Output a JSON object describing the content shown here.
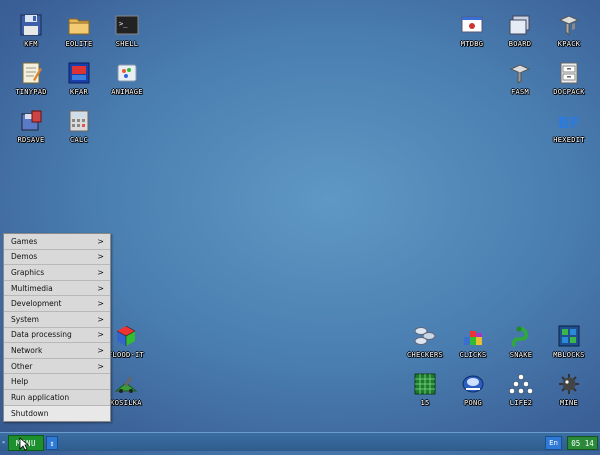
{
  "desktop": {
    "icons": [
      {
        "id": "kfm",
        "label": "KFM",
        "icon": "floppy-icon"
      },
      {
        "id": "eolite",
        "label": "EOLITE",
        "icon": "folder-icon"
      },
      {
        "id": "shell",
        "label": "SHELL",
        "icon": "terminal-icon"
      },
      {
        "id": "tinypad",
        "label": "TINYPAD",
        "icon": "notepad-icon"
      },
      {
        "id": "kfar",
        "label": "KFAR",
        "icon": "kfar-icon"
      },
      {
        "id": "animage",
        "label": "ANIMAGE",
        "icon": "paint-icon"
      },
      {
        "id": "rdsave",
        "label": "RDSAVE",
        "icon": "rdsave-icon"
      },
      {
        "id": "calc",
        "label": "CALC",
        "icon": "calculator-icon"
      },
      {
        "id": "mtdbg",
        "label": "MTDBG",
        "icon": "debugger-icon"
      },
      {
        "id": "board",
        "label": "BOARD",
        "icon": "board-icon"
      },
      {
        "id": "kpack",
        "label": "KPACK",
        "icon": "kpack-icon"
      },
      {
        "id": "fasm",
        "label": "FASM",
        "icon": "fasm-icon"
      },
      {
        "id": "docpack",
        "label": "DOCPACK",
        "icon": "docpack-icon"
      },
      {
        "id": "hexedit",
        "label": "HEXEDIT",
        "icon": "hexedit-icon"
      },
      {
        "id": "flood_it",
        "label": "FLOOD-IT",
        "icon": "cube-icon"
      },
      {
        "id": "kosilka",
        "label": "KOSILKA",
        "icon": "mower-icon"
      },
      {
        "id": "checkers",
        "label": "CHECKERS",
        "icon": "checkers-icon"
      },
      {
        "id": "clicks",
        "label": "CLICKS",
        "icon": "clicks-icon"
      },
      {
        "id": "snake",
        "label": "SNAKE",
        "icon": "snake-icon"
      },
      {
        "id": "mblocks",
        "label": "MBLOCKS",
        "icon": "mblocks-icon"
      },
      {
        "id": "15",
        "label": "15",
        "icon": "fifteen-icon"
      },
      {
        "id": "pong",
        "label": "PONG",
        "icon": "pong-icon"
      },
      {
        "id": "lifes",
        "label": "LIFE2",
        "icon": "life-icon"
      },
      {
        "id": "mine",
        "label": "MINE",
        "icon": "mine-icon"
      }
    ]
  },
  "menu": {
    "items": [
      {
        "label": "Games",
        "has_submenu": true
      },
      {
        "label": "Demos",
        "has_submenu": true
      },
      {
        "label": "Graphics",
        "has_submenu": true
      },
      {
        "label": "Multimedia",
        "has_submenu": true
      },
      {
        "label": "Development",
        "has_submenu": true
      },
      {
        "label": "System",
        "has_submenu": true
      },
      {
        "label": "Data processing",
        "has_submenu": true
      },
      {
        "label": "Network",
        "has_submenu": true
      },
      {
        "label": "Other",
        "has_submenu": true
      },
      {
        "label": "Help",
        "has_submenu": false
      },
      {
        "label": "Run application",
        "has_submenu": false
      },
      {
        "label": "Shutdown",
        "has_submenu": false
      }
    ],
    "arrow": ">"
  },
  "taskbar": {
    "menu_label": "MENU",
    "switch_symbol": "↕",
    "left_arrow": "◂",
    "language": "En",
    "clock": "05 14"
  },
  "colors": {
    "menu_button": "#1e8f2e",
    "clock_bg": "#2a8a3a",
    "lang_bg": "#2f7ad4"
  }
}
